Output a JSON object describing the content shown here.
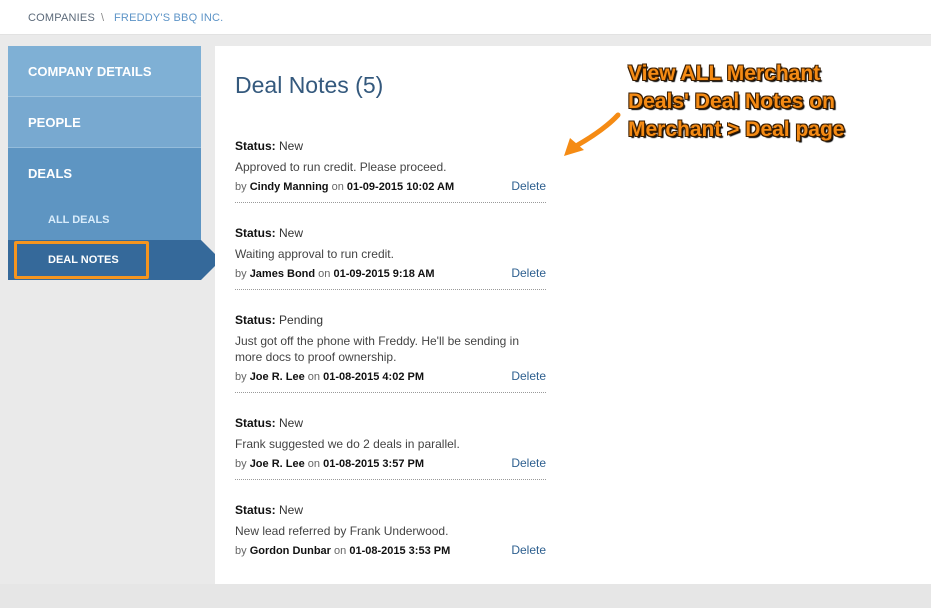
{
  "breadcrumb": {
    "items": [
      "COMPANIES",
      "FREDDY'S BBQ INC."
    ],
    "separator": "\\"
  },
  "sidebar": {
    "items": [
      {
        "label": "COMPANY DETAILS"
      },
      {
        "label": "PEOPLE"
      },
      {
        "label": "DEALS"
      },
      {
        "label": "ALL DEALS"
      },
      {
        "label": "DEAL NOTES"
      }
    ]
  },
  "main": {
    "title": "Deal Notes (5)",
    "notes": [
      {
        "status_label": "Status:",
        "status": "New",
        "text": "Approved to run credit. Please proceed.",
        "by": "by",
        "author": "Cindy Manning",
        "on": "on",
        "date": "01-09-2015 10:02 AM",
        "delete": "Delete"
      },
      {
        "status_label": "Status:",
        "status": "New",
        "text": "Waiting approval to run credit.",
        "by": "by",
        "author": "James Bond",
        "on": "on",
        "date": "01-09-2015 9:18 AM",
        "delete": "Delete"
      },
      {
        "status_label": "Status:",
        "status": "Pending",
        "text": "Just got off the phone with Freddy. He'll be sending in more docs to proof ownership.",
        "by": "by",
        "author": "Joe R. Lee",
        "on": "on",
        "date": "01-08-2015 4:02 PM",
        "delete": "Delete"
      },
      {
        "status_label": "Status:",
        "status": "New",
        "text": "Frank suggested we do 2 deals in parallel.",
        "by": "by",
        "author": "Joe R. Lee",
        "on": "on",
        "date": "01-08-2015 3:57 PM",
        "delete": "Delete"
      },
      {
        "status_label": "Status:",
        "status": "New",
        "text": "New lead referred by Frank Underwood.",
        "by": "by",
        "author": "Gordon Dunbar",
        "on": "on",
        "date": "01-08-2015 3:53 PM",
        "delete": "Delete"
      }
    ]
  },
  "annotation": {
    "lines": [
      "View ALL Merchant",
      "Deals' Deal Notes on",
      "Merchant > Deal page"
    ]
  },
  "colors": {
    "accent": "#f5951f",
    "sidebar_active": "#35699a",
    "title": "#34597d",
    "link": "#2d5f8f"
  }
}
